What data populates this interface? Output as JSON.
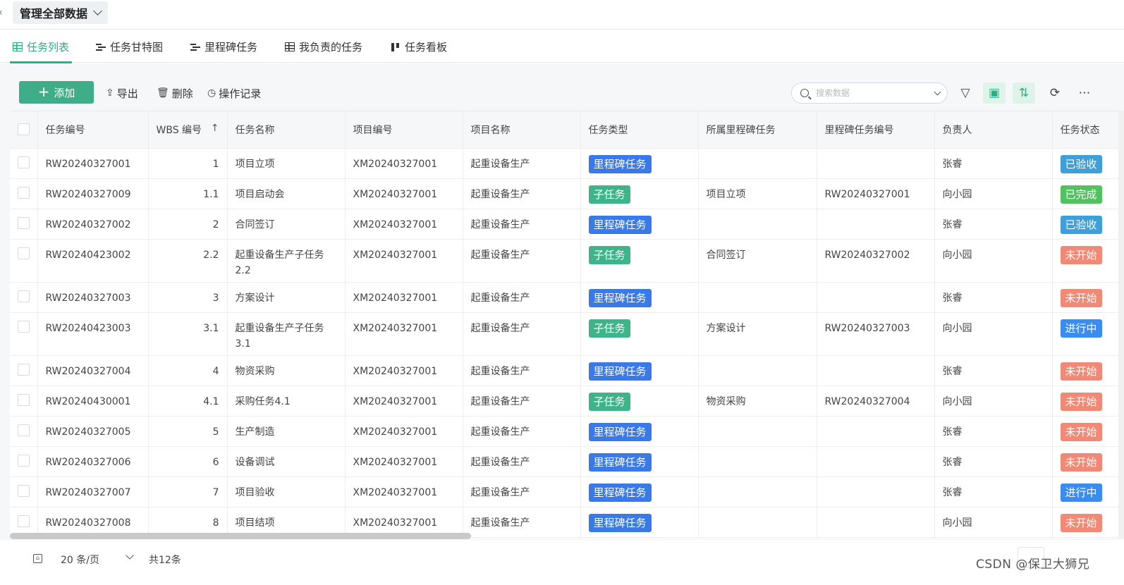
{
  "header": {
    "back_glyph": "‹",
    "scope_label": "管理全部数据"
  },
  "tabs": [
    {
      "label": "任务列表",
      "icon": "grid-icon",
      "active": true
    },
    {
      "label": "任务甘特图",
      "icon": "gantt-icon"
    },
    {
      "label": "里程碑任务",
      "icon": "gantt-icon"
    },
    {
      "label": "我负责的任务",
      "icon": "grid-icon"
    },
    {
      "label": "任务看板",
      "icon": "kanban-icon"
    }
  ],
  "toolbar": {
    "add_label": "添加",
    "export_label": "导出",
    "delete_label": "删除",
    "log_label": "操作记录",
    "search_placeholder": "搜索数据"
  },
  "table": {
    "columns": [
      "任务编号",
      "WBS 编号",
      "任务名称",
      "项目编号",
      "项目名称",
      "任务类型",
      "所属里程碑任务",
      "里程碑任务编号",
      "负责人",
      "任务状态"
    ],
    "rows": [
      {
        "id": "RW20240327001",
        "wbs": "1",
        "name": "项目立项",
        "project_no": "XM20240327001",
        "project_name": "起重设备生产",
        "type": "里程碑任务",
        "milestone": "",
        "milestone_no": "",
        "owner": "张睿",
        "status": "已验收"
      },
      {
        "id": "RW20240327009",
        "wbs": "1.1",
        "name": "项目启动会",
        "project_no": "XM20240327001",
        "project_name": "起重设备生产",
        "type": "子任务",
        "milestone": "项目立项",
        "milestone_no": "RW20240327001",
        "owner": "向小园",
        "status": "已完成"
      },
      {
        "id": "RW20240327002",
        "wbs": "2",
        "name": "合同签订",
        "project_no": "XM20240327001",
        "project_name": "起重设备生产",
        "type": "里程碑任务",
        "milestone": "",
        "milestone_no": "",
        "owner": "张睿",
        "status": "已验收"
      },
      {
        "id": "RW20240423002",
        "wbs": "2.2",
        "name": "起重设备生产子任务2.2",
        "project_no": "XM20240327001",
        "project_name": "起重设备生产",
        "type": "子任务",
        "milestone": "合同签订",
        "milestone_no": "RW20240327002",
        "owner": "向小园",
        "status": "未开始"
      },
      {
        "id": "RW20240327003",
        "wbs": "3",
        "name": "方案设计",
        "project_no": "XM20240327001",
        "project_name": "起重设备生产",
        "type": "里程碑任务",
        "milestone": "",
        "milestone_no": "",
        "owner": "张睿",
        "status": "未开始"
      },
      {
        "id": "RW20240423003",
        "wbs": "3.1",
        "name": "起重设备生产子任务3.1",
        "project_no": "XM20240327001",
        "project_name": "起重设备生产",
        "type": "子任务",
        "milestone": "方案设计",
        "milestone_no": "RW20240327003",
        "owner": "向小园",
        "status": "进行中"
      },
      {
        "id": "RW20240327004",
        "wbs": "4",
        "name": "物资采购",
        "project_no": "XM20240327001",
        "project_name": "起重设备生产",
        "type": "里程碑任务",
        "milestone": "",
        "milestone_no": "",
        "owner": "张睿",
        "status": "未开始"
      },
      {
        "id": "RW20240430001",
        "wbs": "4.1",
        "name": "采购任务4.1",
        "project_no": "XM20240327001",
        "project_name": "起重设备生产",
        "type": "子任务",
        "milestone": "物资采购",
        "milestone_no": "RW20240327004",
        "owner": "向小园",
        "status": "未开始"
      },
      {
        "id": "RW20240327005",
        "wbs": "5",
        "name": "生产制造",
        "project_no": "XM20240327001",
        "project_name": "起重设备生产",
        "type": "里程碑任务",
        "milestone": "",
        "milestone_no": "",
        "owner": "张睿",
        "status": "未开始"
      },
      {
        "id": "RW20240327006",
        "wbs": "6",
        "name": "设备调试",
        "project_no": "XM20240327001",
        "project_name": "起重设备生产",
        "type": "里程碑任务",
        "milestone": "",
        "milestone_no": "",
        "owner": "张睿",
        "status": "未开始"
      },
      {
        "id": "RW20240327007",
        "wbs": "7",
        "name": "项目验收",
        "project_no": "XM20240327001",
        "project_name": "起重设备生产",
        "type": "里程碑任务",
        "milestone": "",
        "milestone_no": "",
        "owner": "张睿",
        "status": "进行中"
      },
      {
        "id": "RW20240327008",
        "wbs": "8",
        "name": "项目结项",
        "project_no": "XM20240327001",
        "project_name": "起重设备生产",
        "type": "里程碑任务",
        "milestone": "",
        "milestone_no": "",
        "owner": "向小园",
        "status": "未开始"
      }
    ]
  },
  "colors": {
    "accent": "#2dae86",
    "type_milestone": "#3a79e8",
    "type_subtask": "#3fb48a",
    "status_accepted": "#3ea0d6",
    "status_done": "#52c160",
    "status_not_started": "#f08a76",
    "status_in_progress": "#3a8cf0"
  },
  "footer": {
    "page_size": "20 条/页",
    "total": "共12条"
  },
  "watermark": "CSDN @保卫大狮兄"
}
